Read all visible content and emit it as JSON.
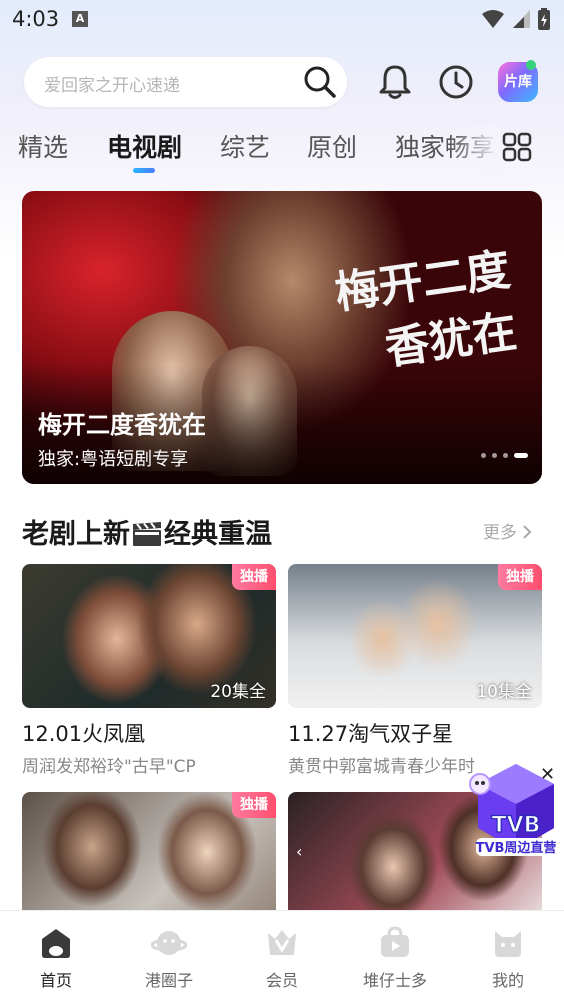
{
  "status_bar": {
    "time": "4:03",
    "notification_icon": "A"
  },
  "search": {
    "placeholder": "爱回家之开心速递"
  },
  "header": {
    "library_label": "片库"
  },
  "tabs": [
    {
      "label": "精选"
    },
    {
      "label": "电视剧",
      "active": true
    },
    {
      "label": "综艺"
    },
    {
      "label": "原创"
    },
    {
      "label": "独家畅享"
    }
  ],
  "banner": {
    "calligraphy": "梅开二度香犹在",
    "title": "梅开二度香犹在",
    "subtitle": "独家:粤语短剧专享",
    "page_count": 4,
    "active_page": 4
  },
  "section": {
    "title_part1": "老剧上新",
    "title_part2": "经典重温",
    "more_label": "更多"
  },
  "cards": [
    {
      "badge": "独播",
      "episodes": "20集全",
      "title": "12.01火凤凰",
      "desc": "周润发郑裕玲\"古早\"CP"
    },
    {
      "badge": "独播",
      "episodes": "10集全",
      "title": "11.27淘气双子星",
      "desc": "黄贯中郭富城青春少年时"
    },
    {
      "badge": "独播"
    },
    {}
  ],
  "floating": {
    "label": "TVB周边直营"
  },
  "bottom_nav": [
    {
      "label": "首页",
      "icon": "home-icon",
      "active": true
    },
    {
      "label": "港圈子",
      "icon": "planet-icon"
    },
    {
      "label": "会员",
      "icon": "vip-icon"
    },
    {
      "label": "堆仔士多",
      "icon": "shop-icon"
    },
    {
      "label": "我的",
      "icon": "profile-icon"
    }
  ],
  "colors": {
    "accent": "#4b7dff",
    "badge": "#ff4f6e"
  }
}
